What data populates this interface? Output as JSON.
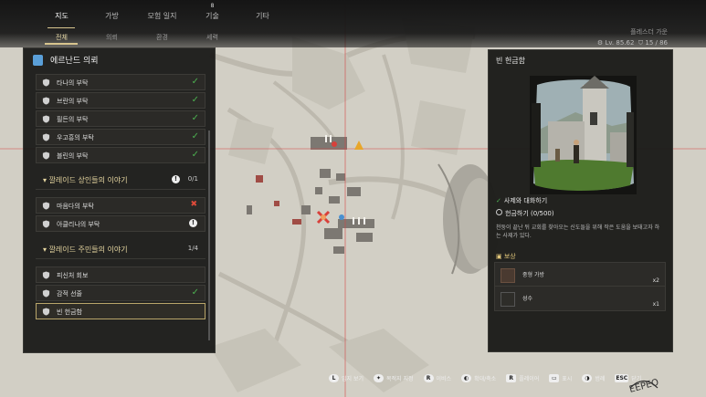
{
  "topnav": {
    "tabs": [
      {
        "label": "지도"
      },
      {
        "label": "가방"
      },
      {
        "label": "모험 일지"
      },
      {
        "label": "기술",
        "badge": "8"
      },
      {
        "label": "기타"
      }
    ],
    "subtabs": [
      {
        "label": "전체"
      },
      {
        "label": "의뢰"
      },
      {
        "label": "환경"
      },
      {
        "label": "세력"
      }
    ]
  },
  "player": {
    "title": "플레스더 가운",
    "level": "Lv. 85.62",
    "shields": "15 / 86"
  },
  "quest_list": {
    "header": "에르난드 의뢰",
    "items": [
      {
        "label": "타나의 부탁",
        "status": "done"
      },
      {
        "label": "브란의 부탁",
        "status": "done"
      },
      {
        "label": "필든의 부탁",
        "status": "done"
      },
      {
        "label": "우고흥의 부탁",
        "status": "done"
      },
      {
        "label": "블린의 부탁",
        "status": "done"
      }
    ],
    "group1": {
      "label": "깔레이드 상인들의 이야기",
      "count": "0/1",
      "info": "!"
    },
    "group1_items": [
      {
        "label": "마음다의 부탁",
        "status": "x"
      },
      {
        "label": "아클리나의 부탁",
        "status": "info"
      }
    ],
    "group2": {
      "label": "깔레이드 주민들의 이야기",
      "count": "1/4"
    },
    "group2_items": [
      {
        "label": "피신처 회보",
        "status": "none"
      },
      {
        "label": "감적 선줄",
        "status": "done"
      },
      {
        "label": "빈 헌금함",
        "status": "selected"
      }
    ]
  },
  "detail": {
    "title": "빈 헌금함",
    "obj1": "사제와 대화하기",
    "obj2": "헌금하기 (0/500)",
    "description": "천둥이 끝난 뒤 교회를 찾아오는 신도들을 위해 작은 도움을 보태고자 하는 사제가 있다.",
    "reward_title": "보상",
    "rewards": [
      {
        "name": "중형 가방",
        "qty": "x2"
      },
      {
        "name": "성수",
        "qty": "x1"
      }
    ]
  },
  "controls": [
    {
      "key": "L",
      "label": "임지 보기"
    },
    {
      "key": "✦",
      "label": "목적지 지정"
    },
    {
      "key": "R",
      "label": "이비스"
    },
    {
      "key": "◐",
      "label": "확대/축소"
    },
    {
      "key": "R",
      "label": "플레이어"
    },
    {
      "key": "▭",
      "label": "표시"
    },
    {
      "key": "◑",
      "label": "범례"
    },
    {
      "key": "ESC",
      "label": "닫기"
    }
  ],
  "colors": {
    "accent": "#d8c58e",
    "check": "#4caf50",
    "alert": "#e04b3a",
    "quest_tag": "#5a9fd8"
  }
}
